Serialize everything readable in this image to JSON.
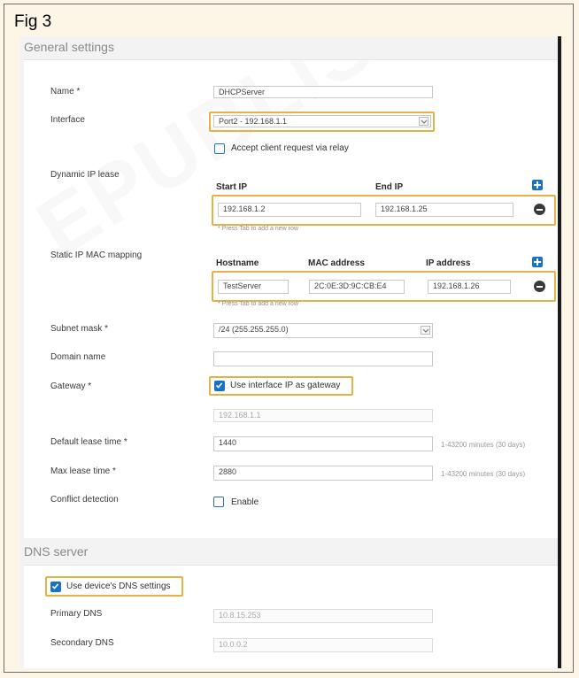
{
  "figure": {
    "label": "Fig 3"
  },
  "watermark": "EPUBLIS",
  "general": {
    "title": "General settings",
    "name_label": "Name *",
    "name_value": "DHCPServer",
    "interface_label": "Interface",
    "interface_value": "Port2 - 192.168.1.1",
    "relay_label": "Accept client request via relay",
    "dynamic_label": "Dynamic IP lease",
    "start_ip_header": "Start IP",
    "end_ip_header": "End IP",
    "start_ip_value": "192.168.1.2",
    "end_ip_value": "192.168.1.25",
    "dynamic_hint": "* Press Tab to add a new row",
    "static_label": "Static IP MAC mapping",
    "hostname_header": "Hostname",
    "mac_header": "MAC address",
    "ip_header": "IP address",
    "hostname_value": "TestServer",
    "mac_value": "2C:0E:3D:9C:CB:E4",
    "ip_value": "192.168.1.26",
    "static_hint": "* Press Tab to add a new row",
    "subnet_label": "Subnet mask *",
    "subnet_value": "/24 (255.255.255.0)",
    "domain_label": "Domain name",
    "domain_value": "",
    "gateway_label": "Gateway *",
    "gateway_checkbox_label": "Use interface IP as gateway",
    "gateway_value": "192.168.1.1",
    "default_lease_label": "Default lease time *",
    "default_lease_value": "1440",
    "default_lease_note": "1-43200 minutes (30 days)",
    "max_lease_label": "Max lease time *",
    "max_lease_value": "2880",
    "max_lease_note": "1-43200 minutes (30 days)",
    "conflict_label": "Conflict detection",
    "conflict_checkbox_label": "Enable"
  },
  "dns": {
    "title": "DNS server",
    "use_device_label": "Use device's DNS settings",
    "primary_label": "Primary DNS",
    "primary_value": "10.8.15.253",
    "secondary_label": "Secondary DNS",
    "secondary_value": "10.0.0.2"
  },
  "colors": {
    "highlight": "#e7b245",
    "accent": "#1a72c4",
    "background": "#fdf6e6"
  }
}
